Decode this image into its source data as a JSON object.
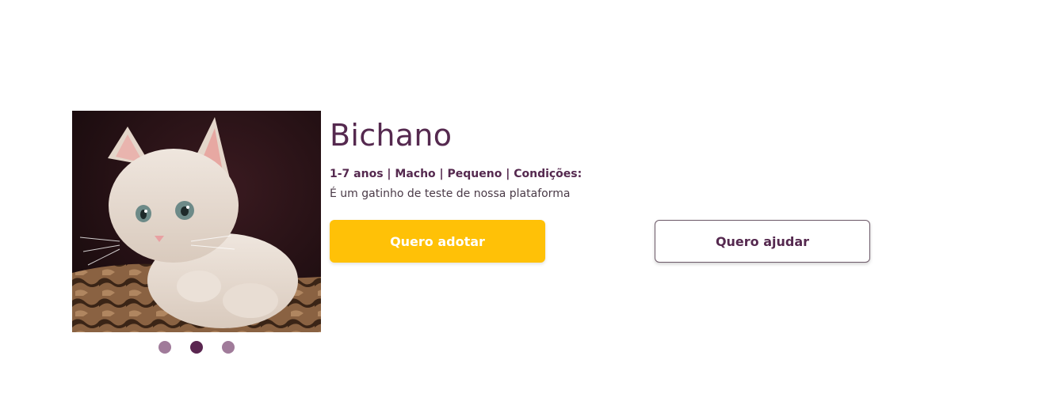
{
  "pet": {
    "name": "Bichano",
    "attributes": "1-7 anos | Macho | Pequeno | Condições:",
    "description": "É um gatinho de teste de nossa plataforma",
    "photo_icon": "kitten-photo"
  },
  "carousel": {
    "active_index": 1,
    "dot_count": 3
  },
  "actions": {
    "adopt_label": "Quero adotar",
    "help_label": "Quero ajudar"
  },
  "colors": {
    "brand_purple": "#55294f",
    "dot_inactive": "#a07b9a",
    "dot_active": "#5a2650",
    "adopt_yellow": "#ffc107"
  }
}
